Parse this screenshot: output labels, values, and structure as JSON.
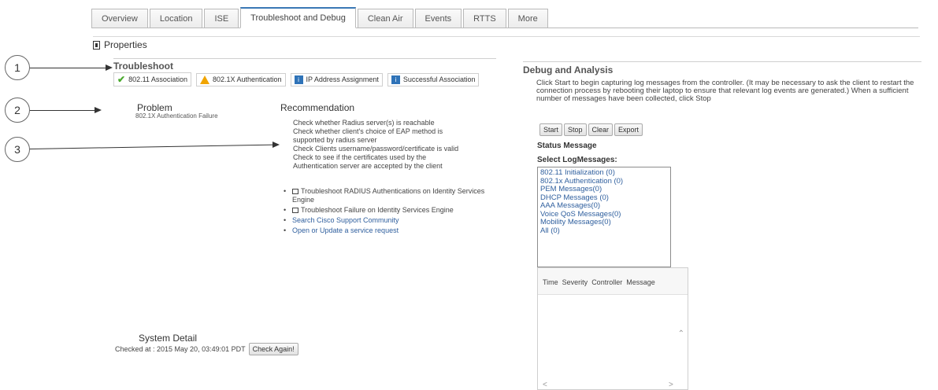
{
  "tabs": [
    {
      "label": "Overview"
    },
    {
      "label": "Location"
    },
    {
      "label": "ISE"
    },
    {
      "label": "Troubleshoot and Debug"
    },
    {
      "label": "Clean Air"
    },
    {
      "label": "Events"
    },
    {
      "label": "RTTS"
    },
    {
      "label": "More"
    }
  ],
  "properties_label": "Properties",
  "callouts": [
    "1",
    "2",
    "3"
  ],
  "troubleshoot": {
    "title": "Troubleshoot",
    "steps": [
      {
        "label": "802.11 Association",
        "icon": "check-icon"
      },
      {
        "label": "802.1X Authentication",
        "icon": "warning-icon"
      },
      {
        "label": "IP Address Assignment",
        "icon": "info-icon"
      },
      {
        "label": "Successful Association",
        "icon": "info-icon"
      }
    ]
  },
  "problem": {
    "title": "Problem",
    "text": "802.1X Authentication Failure"
  },
  "recommendation": {
    "title": "Recommendation",
    "lines": [
      "Check whether Radius server(s) is reachable",
      "Check whether client's choice of EAP method is",
      "supported by radius server",
      "Check Clients username/password/certificate is valid",
      "Check to see if the certificates used by the",
      "Authentication server are accepted by the client"
    ],
    "links": [
      "Troubleshoot RADIUS Authentications on Identity Services Engine",
      "Troubleshoot Failure on Identity Services Engine",
      "Search Cisco Support Community",
      "Open or Update a service request"
    ]
  },
  "system_detail": {
    "title": "System Detail",
    "checked_at": "Checked at : 2015 May 20, 03:49:01 PDT",
    "check_again": "Check Again!"
  },
  "debug": {
    "title": "Debug and Analysis",
    "description": "Click Start to begin capturing log messages from the controller. (It may be necessary to ask the client to restart the connection process by rebooting their laptop to ensure that relevant log events are generated.) When a sufficient number of messages have been collected, click Stop",
    "buttons": [
      "Start",
      "Stop",
      "Clear",
      "Export"
    ],
    "status_label": "Status Message",
    "select_label": "Select LogMessages:",
    "log_items": [
      "802.11 Initialization (0)",
      "802.1x Authentication (0)",
      "PEM Messages(0)",
      "DHCP Messages (0)",
      "AAA Messages(0)",
      "Voice QoS Messages(0)",
      "Mobility Messages(0)",
      "All (0)"
    ],
    "table_headers": [
      "Time",
      "Severity",
      "Controller",
      "Message"
    ]
  }
}
